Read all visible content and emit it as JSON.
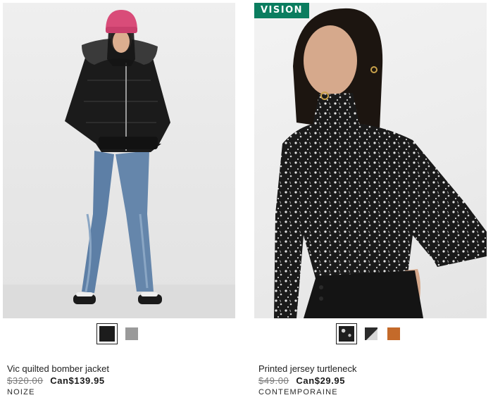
{
  "products": [
    {
      "name": "Vic quilted bomber jacket",
      "price_original": "$320.00",
      "price_sale": "Can$139.95",
      "brand": "NOIZE",
      "swatches": [
        {
          "label": "black",
          "color": "#1c1c1c",
          "selected": true
        },
        {
          "label": "grey",
          "color": "#9a9a9a",
          "selected": false
        }
      ]
    },
    {
      "badge": "VISION",
      "name": "Printed jersey turtleneck",
      "price_original": "$49.00",
      "price_sale": "Can$29.95",
      "brand": "CONTEMPORAINE",
      "swatches": [
        {
          "label": "black floral",
          "color": "#1e1e1e",
          "selected": true
        },
        {
          "label": "black and white",
          "color": "#2b2b2b",
          "selected": false
        },
        {
          "label": "rust",
          "color": "#c46a2a",
          "selected": false
        }
      ]
    }
  ],
  "colors": {
    "badge_bg": "#0b7d5f",
    "strike_price": "#7a7a7a"
  }
}
